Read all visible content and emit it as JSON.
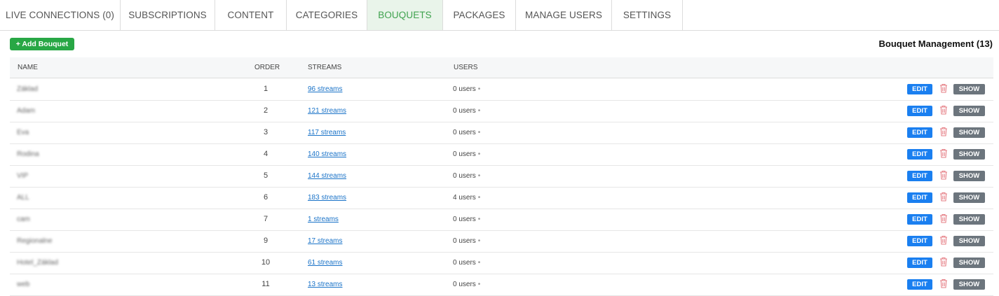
{
  "nav": {
    "tabs": [
      {
        "label": "LIVE CONNECTIONS (0)",
        "active": false
      },
      {
        "label": "SUBSCRIPTIONS",
        "active": false
      },
      {
        "label": "CONTENT",
        "active": false
      },
      {
        "label": "CATEGORIES",
        "active": false
      },
      {
        "label": "BOUQUETS",
        "active": true
      },
      {
        "label": "PACKAGES",
        "active": false
      },
      {
        "label": "MANAGE USERS",
        "active": false
      },
      {
        "label": "SETTINGS",
        "active": false
      }
    ]
  },
  "toolbar": {
    "add_label": "+ Add Bouquet"
  },
  "page": {
    "title": "Bouquet Management (13)"
  },
  "table": {
    "headers": {
      "name": "NAME",
      "order": "ORDER",
      "streams": "STREAMS",
      "users": "USERS"
    },
    "rows": [
      {
        "name": "Základ",
        "order": "1",
        "streams": "96 streams",
        "users": "0 users"
      },
      {
        "name": "Adam",
        "order": "2",
        "streams": "121 streams",
        "users": "0 users"
      },
      {
        "name": "Eva",
        "order": "3",
        "streams": "117 streams",
        "users": "0 users"
      },
      {
        "name": "Rodina",
        "order": "4",
        "streams": "140 streams",
        "users": "0 users"
      },
      {
        "name": "VIP",
        "order": "5",
        "streams": "144 streams",
        "users": "0 users"
      },
      {
        "name": "ALL",
        "order": "6",
        "streams": "183 streams",
        "users": "4 users"
      },
      {
        "name": "cam",
        "order": "7",
        "streams": "1 streams",
        "users": "0 users"
      },
      {
        "name": "Regionalne",
        "order": "9",
        "streams": "17 streams",
        "users": "0 users"
      },
      {
        "name": "Hotel_Základ",
        "order": "10",
        "streams": "61 streams",
        "users": "0 users"
      },
      {
        "name": "web",
        "order": "11",
        "streams": "13 streams",
        "users": "0 users"
      }
    ],
    "edit_label": "EDIT",
    "show_label": "SHOW",
    "users_dot": "•"
  },
  "colors": {
    "active_tab_bg": "#e9f4ea",
    "active_tab_text": "#3fa24e",
    "add_button": "#28a745",
    "edit_button": "#1a7ff0",
    "show_button": "#6c757d",
    "delete_icon": "#e57f86",
    "link": "#1a73c8"
  },
  "icons": {
    "delete": "trash-icon"
  }
}
